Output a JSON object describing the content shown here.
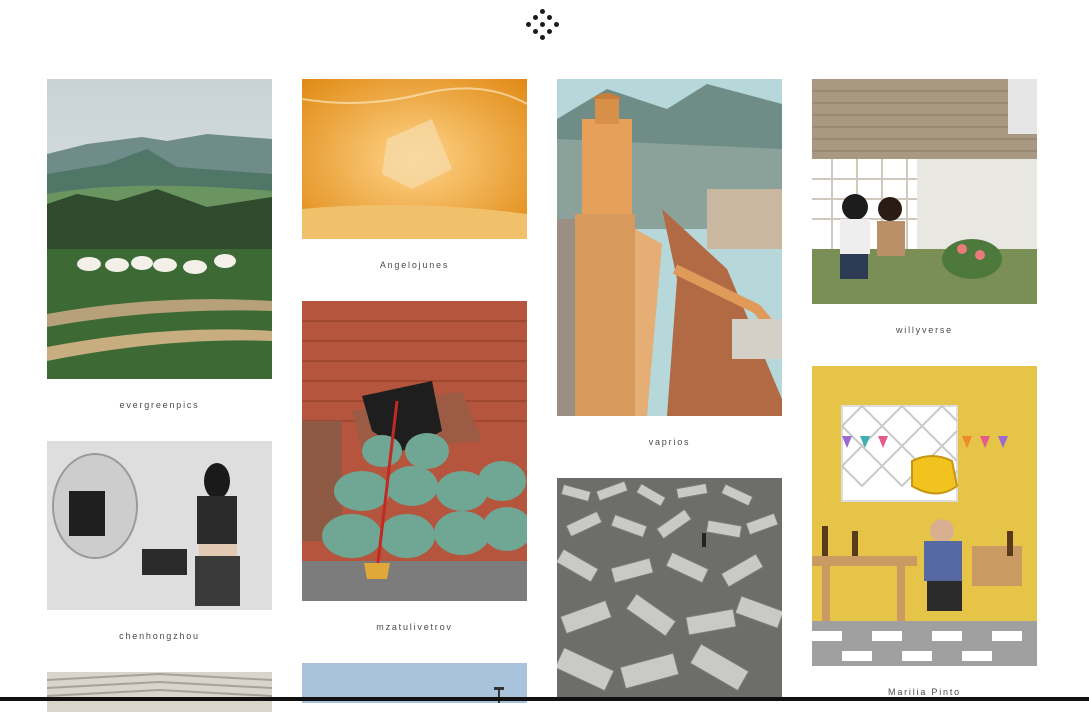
{
  "logo": {
    "icon": "dot-diamond-logo-icon"
  },
  "columns": [
    {
      "cards": [
        {
          "caption": "evergreenpics",
          "scene": "mountain meadow with white cows and dirt road"
        },
        {
          "caption": "chenhongzhou",
          "scene": "woman in black crop top beside round mirror"
        },
        {
          "caption": "",
          "scene": "partially visible striped roof"
        }
      ]
    },
    {
      "cards": [
        {
          "caption": "Angelojunes",
          "scene": "golden water with submerged fabric"
        },
        {
          "caption": "mzatulivetrov",
          "scene": "pile of green sacks before red brick wall with broom"
        },
        {
          "caption": "",
          "scene": "partially visible blue sky"
        }
      ]
    },
    {
      "cards": [
        {
          "caption": "vaprios",
          "scene": "orange fortress walls with hills behind"
        },
        {
          "caption": "",
          "scene": "field of grey concrete tetrapods"
        }
      ]
    },
    {
      "cards": [
        {
          "caption": "willyverse",
          "scene": "two women sitting by a house with lattice"
        },
        {
          "caption": "Marilia Pinto",
          "scene": "woman seated at market stall with yellow wall and bunting"
        }
      ]
    }
  ]
}
